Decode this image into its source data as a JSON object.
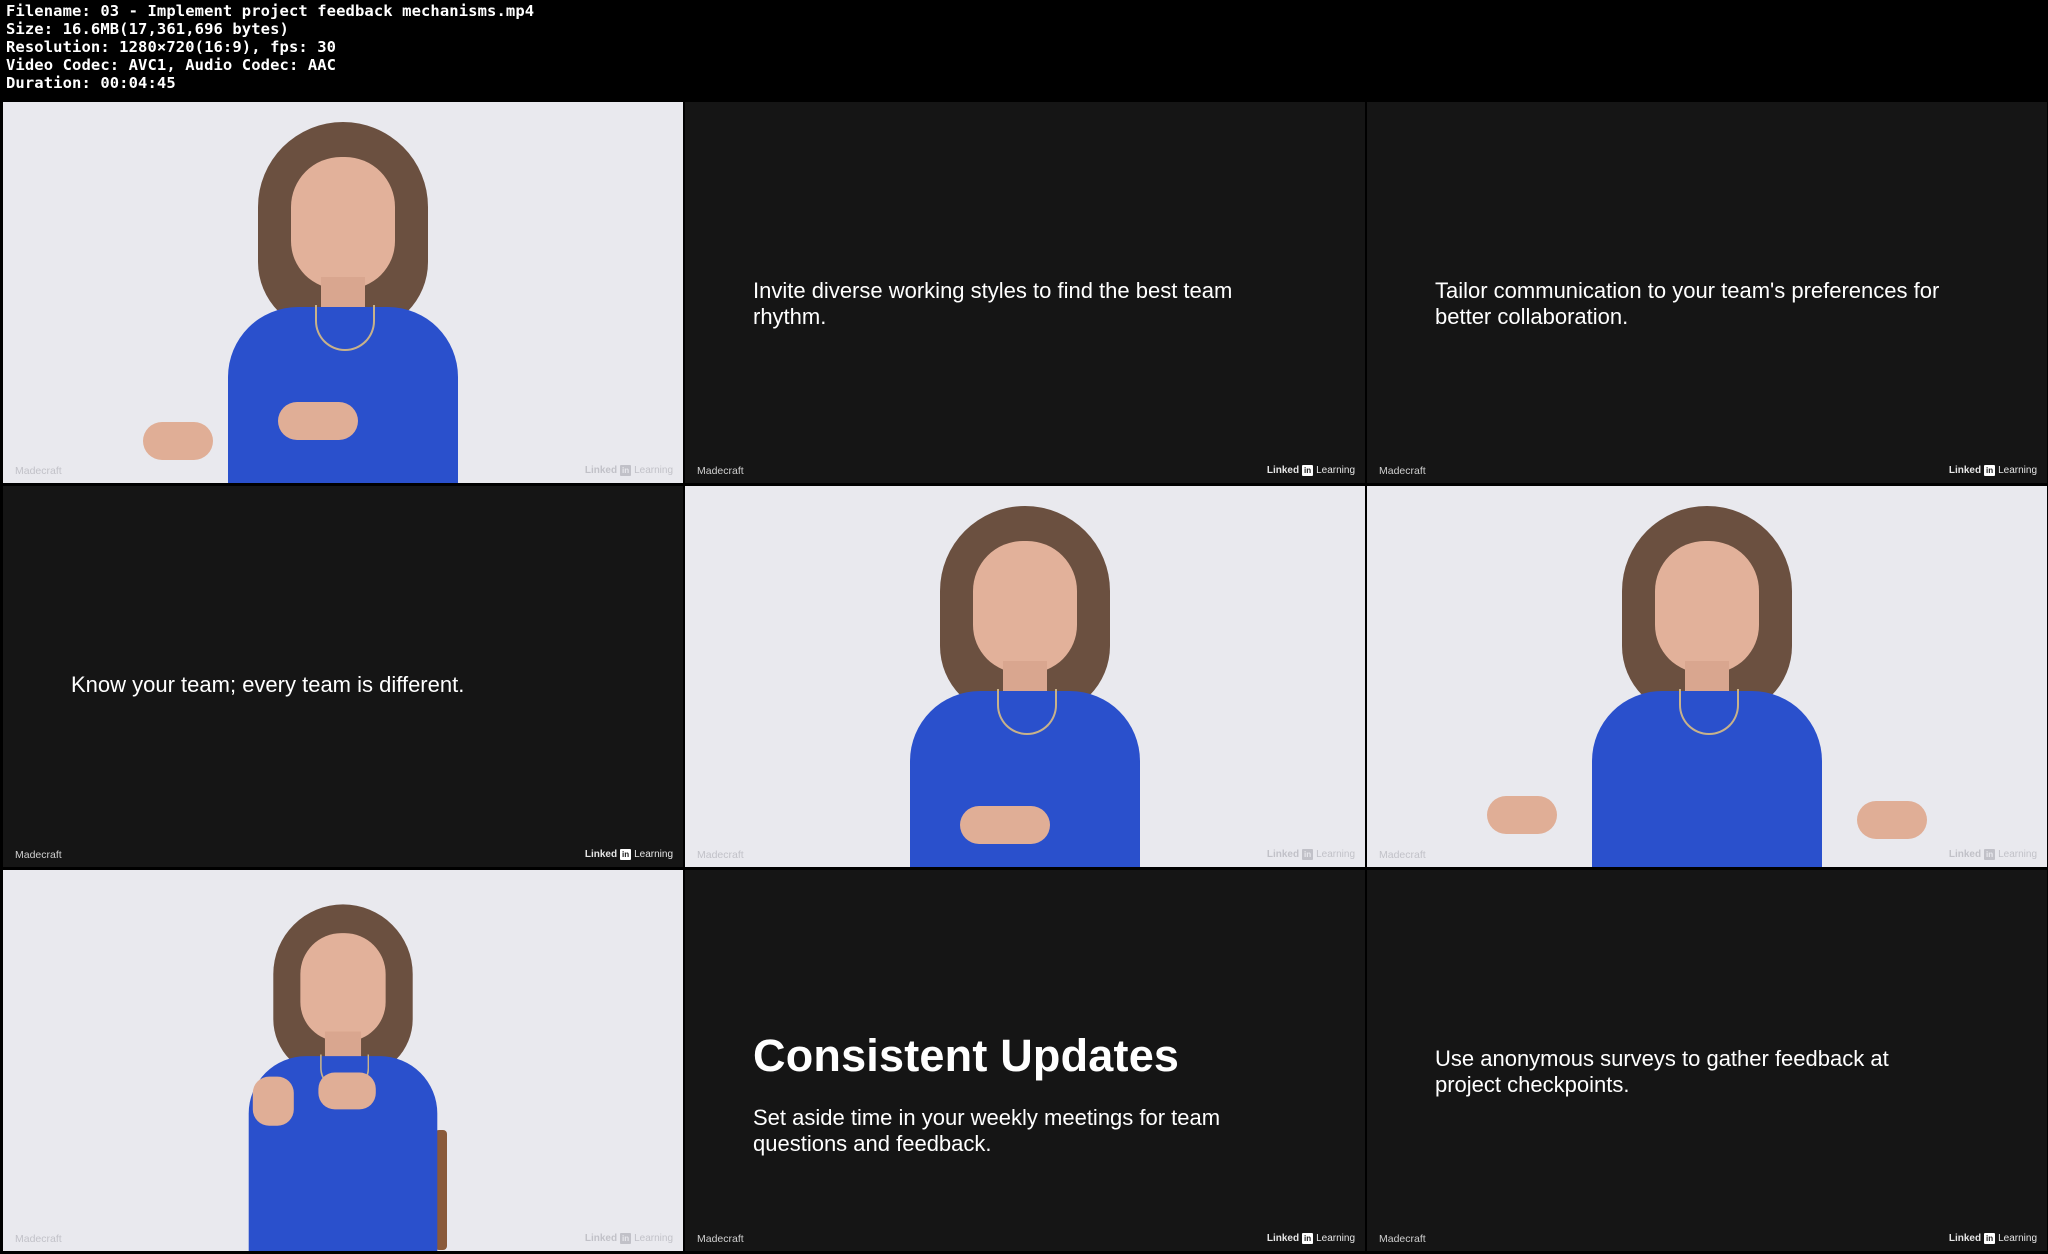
{
  "header": {
    "filename": "Filename: 03 - Implement project feedback mechanisms.mp4",
    "size": "Size: 16.6MB(17,361,696 bytes)",
    "resolution": "Resolution: 1280×720(16:9), fps: 30",
    "codecs": "Video Codec: AVC1, Audio Codec: AAC",
    "duration": "Duration: 00:04:45"
  },
  "branding": {
    "producer": "Madecraft",
    "platform_word": "Linked",
    "platform_box": "in",
    "platform_suffix": "Learning"
  },
  "frames": [
    {
      "type": "video"
    },
    {
      "type": "slide",
      "text": "Invite diverse working styles to find the best team rhythm."
    },
    {
      "type": "slide",
      "text": "Tailor communication to your team's preferences for better collaboration."
    },
    {
      "type": "slide",
      "text": "Know your team; every team is different."
    },
    {
      "type": "video"
    },
    {
      "type": "video"
    },
    {
      "type": "video"
    },
    {
      "type": "slide",
      "title": "Consistent Updates",
      "text": "Set aside time in your weekly meetings for team questions and feedback."
    },
    {
      "type": "slide",
      "text": "Use anonymous surveys to gather feedback at project checkpoints."
    }
  ],
  "colors": {
    "slide_background": "#151515",
    "video_background": "#e9e9ee",
    "shirt": "#2a50cc"
  }
}
